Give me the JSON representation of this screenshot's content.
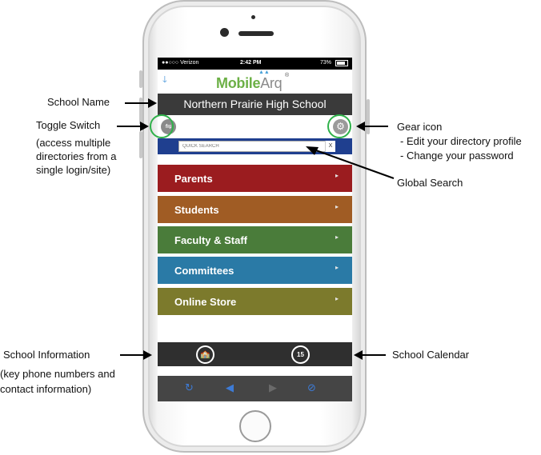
{
  "status_bar": {
    "carrier": "●●○○○ Verizon",
    "time": "2:42 PM",
    "battery": "73%"
  },
  "app": {
    "logo_part1": "Mobile",
    "logo_part2": "Arq",
    "logo_registered": "®"
  },
  "school": {
    "name": "Northern Prairie High School"
  },
  "search": {
    "placeholder": "QUICK SEARCH",
    "clear_label": "X"
  },
  "menu": [
    {
      "label": "Parents",
      "color": "#9b1c1f"
    },
    {
      "label": "Students",
      "color": "#a05c24"
    },
    {
      "label": "Faculty & Staff",
      "color": "#4a7c3a"
    },
    {
      "label": "Committees",
      "color": "#2a7aa6"
    },
    {
      "label": "Online Store",
      "color": "#7c7a2c"
    }
  ],
  "footer": {
    "calendar_day": "15"
  },
  "annotations": {
    "school_name": "School Name",
    "toggle_switch": "Toggle Switch",
    "toggle_desc": [
      "(access multiple",
      "directories from a",
      "single login/site)"
    ],
    "gear_icon": "Gear icon",
    "gear_desc": [
      "- Edit your directory profile",
      "- Change your password"
    ],
    "global_search": "Global Search",
    "school_info": "School Information",
    "school_info_desc": [
      "(key phone numbers and",
      "contact information)"
    ],
    "school_calendar": "School Calendar"
  },
  "colors": {
    "ring": "#2fb14a",
    "search_bar": "#1f3f8f",
    "school_bar": "#3a3a3a"
  }
}
